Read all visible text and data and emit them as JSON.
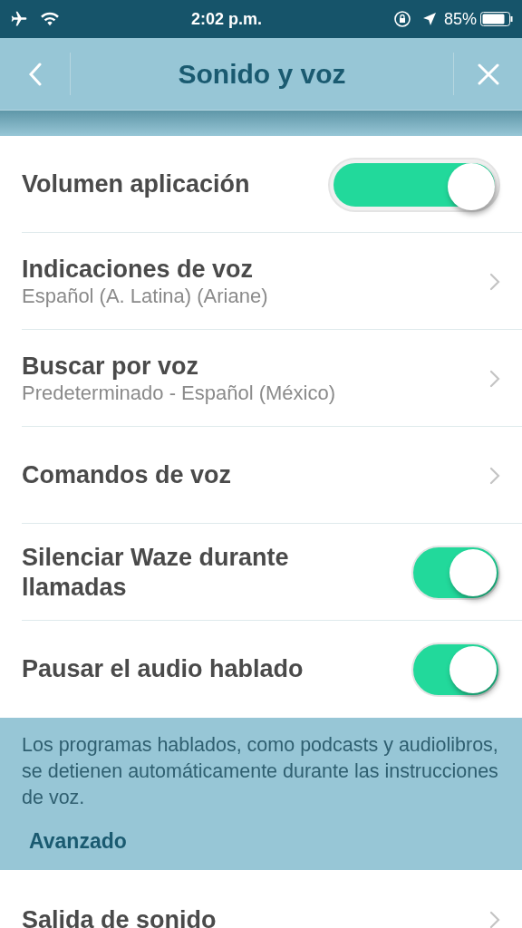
{
  "status_bar": {
    "time": "2:02 p.m.",
    "battery": "85%"
  },
  "header": {
    "title": "Sonido y voz"
  },
  "settings": [
    {
      "kind": "slider",
      "title": "Volumen aplicación",
      "level": 1
    },
    {
      "kind": "link",
      "title": "Indicaciones de voz",
      "subtitle": "Español (A. Latina) (Ariane)"
    },
    {
      "kind": "link",
      "title": "Buscar por voz",
      "subtitle": "Predeterminado - Español (México)"
    },
    {
      "kind": "link",
      "title": "Comandos de voz"
    },
    {
      "kind": "toggle",
      "title": "Silenciar Waze durante llamadas",
      "on": true
    },
    {
      "kind": "toggle",
      "title": "Pausar el audio hablado",
      "on": true
    }
  ],
  "note": "Los programas hablados, como podcasts y audiolibros, se detienen automáticamente durante las instrucciones de voz.",
  "section_title": "Avanzado",
  "advanced": [
    {
      "kind": "link",
      "title": "Salida de sonido"
    }
  ]
}
